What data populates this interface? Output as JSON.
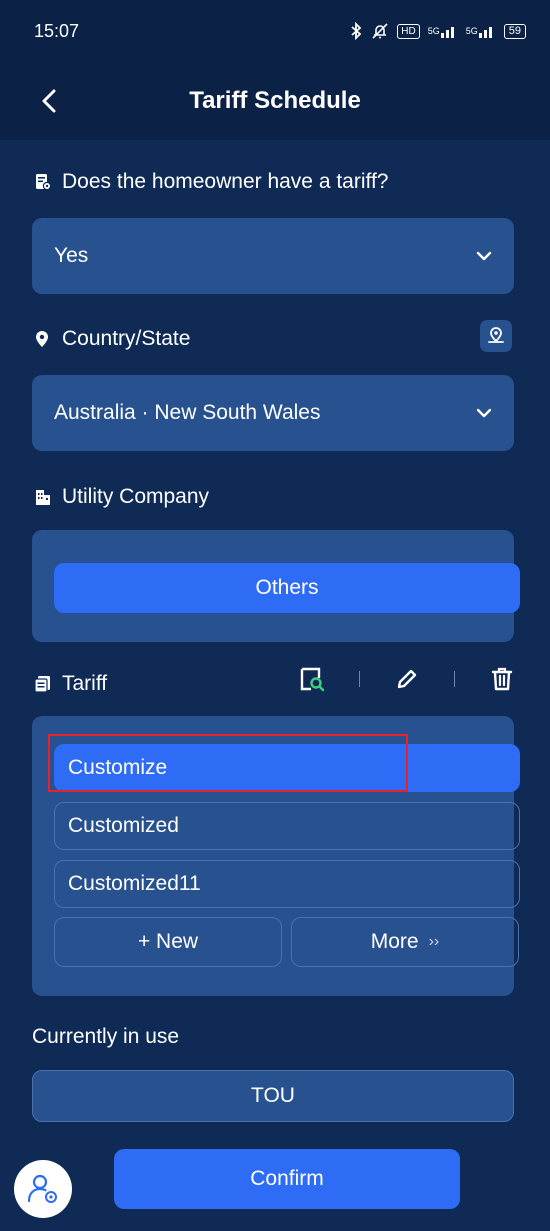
{
  "status_bar": {
    "time": "15:07",
    "bluetooth_icon": "bluetooth-icon",
    "mute_icon": "bell-off-icon",
    "hd_badge": "HD",
    "signal1": "5G",
    "signal2": "5G",
    "battery": "59"
  },
  "header": {
    "title": "Tariff Schedule"
  },
  "tariff_question": {
    "label": "Does the homeowner have a tariff?",
    "value": "Yes"
  },
  "country_state": {
    "label": "Country/State",
    "value": "Australia · New South Wales"
  },
  "utility_company": {
    "label": "Utility Company",
    "button": "Others"
  },
  "tariff": {
    "label": "Tariff",
    "options": [
      "Customize",
      "Customized",
      "Customized11"
    ],
    "selected_index": 0,
    "new_button": "+ New",
    "more_button": "More",
    "more_chevron": "››"
  },
  "current": {
    "label": "Currently in use",
    "value": "TOU"
  },
  "footer": {
    "confirm": "Confirm"
  },
  "colors": {
    "background": "#0e2a55",
    "card": "#27518f",
    "accent": "#2f6cf6",
    "highlight": "#e8222a"
  }
}
